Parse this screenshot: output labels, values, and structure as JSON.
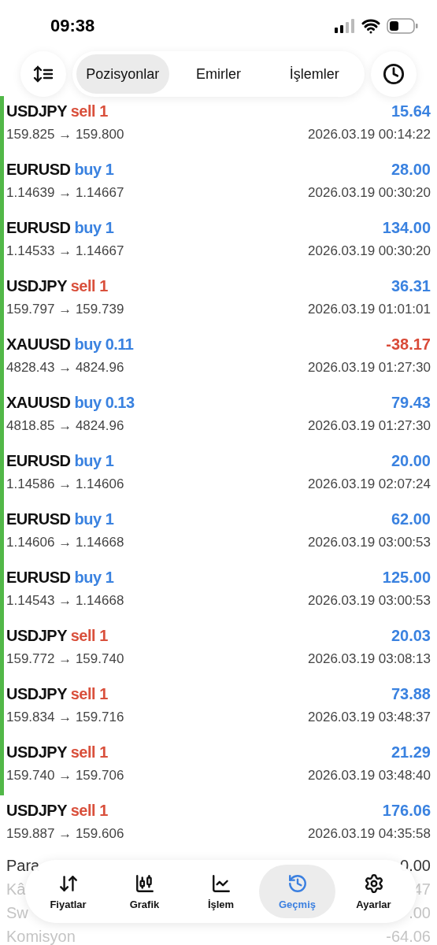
{
  "status_bar": {
    "time": "09:38"
  },
  "top_bar": {
    "tabs": [
      {
        "label": "Pozisyonlar",
        "selected": true
      },
      {
        "label": "Emirler",
        "selected": false
      },
      {
        "label": "İşlemler",
        "selected": false
      }
    ]
  },
  "trades": [
    {
      "symbol": "USDJPY",
      "color": "#d9503c",
      "volume": "sell 1",
      "profit": "15.64",
      "loss": false,
      "prices": "159.825 → 159.800",
      "time": "2026.03.19 00:14:22",
      "marked": true
    },
    {
      "symbol": "EURUSD",
      "color": "#3a82e0",
      "volume": "buy 1",
      "profit": "28.00",
      "loss": false,
      "prices": "1.14639 → 1.14667",
      "time": "2026.03.19 00:30:20",
      "marked": true
    },
    {
      "symbol": "EURUSD",
      "color": "#3a82e0",
      "volume": "buy 1",
      "profit": "134.00",
      "loss": false,
      "prices": "1.14533 → 1.14667",
      "time": "2026.03.19 00:30:20",
      "marked": true
    },
    {
      "symbol": "USDJPY",
      "color": "#d9503c",
      "volume": "sell 1",
      "profit": "36.31",
      "loss": false,
      "prices": "159.797 → 159.739",
      "time": "2026.03.19 01:01:01",
      "marked": true
    },
    {
      "symbol": "XAUUSD",
      "color": "#3a82e0",
      "volume": "buy 0.11",
      "profit": "-38.17",
      "loss": true,
      "prices": "4828.43 → 4824.96",
      "time": "2026.03.19 01:27:30",
      "marked": true
    },
    {
      "symbol": "XAUUSD",
      "color": "#3a82e0",
      "volume": "buy 0.13",
      "profit": "79.43",
      "loss": false,
      "prices": "4818.85 → 4824.96",
      "time": "2026.03.19 01:27:30",
      "marked": true
    },
    {
      "symbol": "EURUSD",
      "color": "#3a82e0",
      "volume": "buy 1",
      "profit": "20.00",
      "loss": false,
      "prices": "1.14586 → 1.14606",
      "time": "2026.03.19 02:07:24",
      "marked": true
    },
    {
      "symbol": "EURUSD",
      "color": "#3a82e0",
      "volume": "buy 1",
      "profit": "62.00",
      "loss": false,
      "prices": "1.14606 → 1.14668",
      "time": "2026.03.19 03:00:53",
      "marked": true
    },
    {
      "symbol": "EURUSD",
      "color": "#3a82e0",
      "volume": "buy 1",
      "profit": "125.00",
      "loss": false,
      "prices": "1.14543 → 1.14668",
      "time": "2026.03.19 03:00:53",
      "marked": true
    },
    {
      "symbol": "USDJPY",
      "color": "#d9503c",
      "volume": "sell 1",
      "profit": "20.03",
      "loss": false,
      "prices": "159.772 → 159.740",
      "time": "2026.03.19 03:08:13",
      "marked": true
    },
    {
      "symbol": "USDJPY",
      "color": "#d9503c",
      "volume": "sell 1",
      "profit": "73.88",
      "loss": false,
      "prices": "159.834 → 159.716",
      "time": "2026.03.19 03:48:37",
      "marked": true
    },
    {
      "symbol": "USDJPY",
      "color": "#d9503c",
      "volume": "sell 1",
      "profit": "21.29",
      "loss": false,
      "prices": "159.740 → 159.706",
      "time": "2026.03.19 03:48:40",
      "marked": true
    },
    {
      "symbol": "USDJPY",
      "color": "#d9503c",
      "volume": "sell 1",
      "profit": "176.06",
      "loss": false,
      "prices": "159.887 → 159.606",
      "time": "2026.03.19 04:35:58",
      "marked": false
    }
  ],
  "summary": [
    {
      "label": "Para",
      "value": "0.00",
      "dimmed": false
    },
    {
      "label": "Kâ",
      "value": "47",
      "dimmed": true
    },
    {
      "label": "Sw",
      "value": ".00",
      "dimmed": true
    },
    {
      "label": "Komisyon",
      "value": "-64.06",
      "dimmed": true
    }
  ],
  "bottom_nav": [
    {
      "label": "Fiyatlar",
      "kind": "quotes",
      "selected": false
    },
    {
      "label": "Grafik",
      "kind": "chart",
      "selected": false
    },
    {
      "label": "İşlem",
      "kind": "trade",
      "selected": false
    },
    {
      "label": "Geçmiş",
      "kind": "history",
      "selected": true
    },
    {
      "label": "Ayarlar",
      "kind": "settings",
      "selected": false
    }
  ]
}
